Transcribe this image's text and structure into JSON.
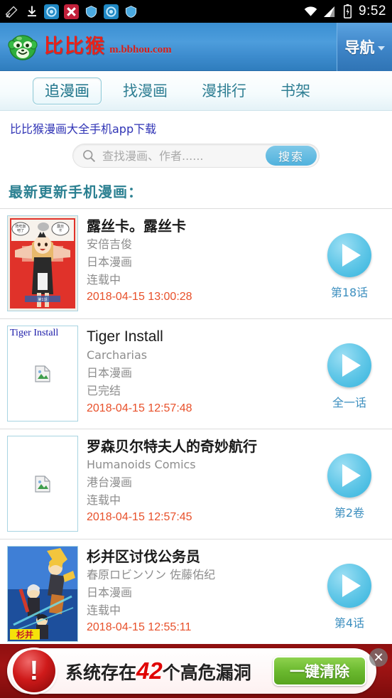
{
  "statusbar": {
    "icons": [
      "tool-slash-icon",
      "download-icon",
      "sync-circle-icon",
      "x-badge-icon",
      "shield-icon",
      "sync-circle-icon",
      "shield-icon"
    ],
    "wifi_icon": "wifi-icon",
    "signal_icon": "cell-signal-icon",
    "battery_icon": "battery-charging-icon",
    "time": "9:52"
  },
  "header": {
    "logo_icon": "monkey-logo-icon",
    "brand_cn": "比比猴",
    "brand_url": "m.bbhou.com",
    "nav_label": "导航",
    "nav_caret_icon": "chevron-down-icon"
  },
  "tabs": [
    {
      "label": "追漫画",
      "active": true
    },
    {
      "label": "找漫画",
      "active": false
    },
    {
      "label": "漫排行",
      "active": false
    },
    {
      "label": "书架",
      "active": false
    }
  ],
  "app_link": "比比猴漫画大全手机app下载",
  "search": {
    "icon": "search-icon",
    "placeholder": "查找漫画、作者......",
    "value": "",
    "button_label": "搜索"
  },
  "section_title": "最新更新手机漫画：",
  "items": [
    {
      "title": "露丝卡。露丝卡",
      "author": "安倍吉俊",
      "category": "日本漫画",
      "status": "连载中",
      "date": "2018-04-15 13:00:28",
      "chapter": "第18话",
      "thumb_kind": "cover",
      "thumb_alt": "",
      "play_icon": "play-icon"
    },
    {
      "title": "Tiger Install",
      "author": "Carcharias",
      "category": "日本漫画",
      "status": "已完结",
      "date": "2018-04-15 12:57:48",
      "chapter": "全一话",
      "thumb_kind": "broken",
      "thumb_alt": "Tiger Install",
      "play_icon": "play-icon"
    },
    {
      "title": "罗森贝尔特夫人的奇妙航行",
      "author": "Humanoids Comics",
      "category": "港台漫画",
      "status": "连载中",
      "date": "2018-04-15 12:57:45",
      "chapter": "第2卷",
      "thumb_kind": "broken",
      "thumb_alt": "",
      "play_icon": "play-icon"
    },
    {
      "title": "杉并区讨伐公务员",
      "author": "春原ロビンソン 佐藤佑纪",
      "category": "日本漫画",
      "status": "连载中",
      "date": "2018-04-15 12:55:11",
      "chapter": "第4话",
      "thumb_kind": "cover2",
      "thumb_alt": "",
      "play_icon": "play-icon"
    }
  ],
  "ad": {
    "warning_icon": "warning-exclamation-icon",
    "text_before": "系统存在",
    "count": "42",
    "text_after": "个高危漏洞",
    "button_label": "一键清除",
    "close_icon": "close-icon"
  },
  "colors": {
    "brand_red": "#e8221a",
    "header_blue": "#3d8cce",
    "tab_teal": "#2e7e93",
    "date_orange": "#e8502a",
    "play_cyan": "#34b3dd",
    "ad_green": "#6bb92f",
    "ad_red": "#e00000"
  }
}
